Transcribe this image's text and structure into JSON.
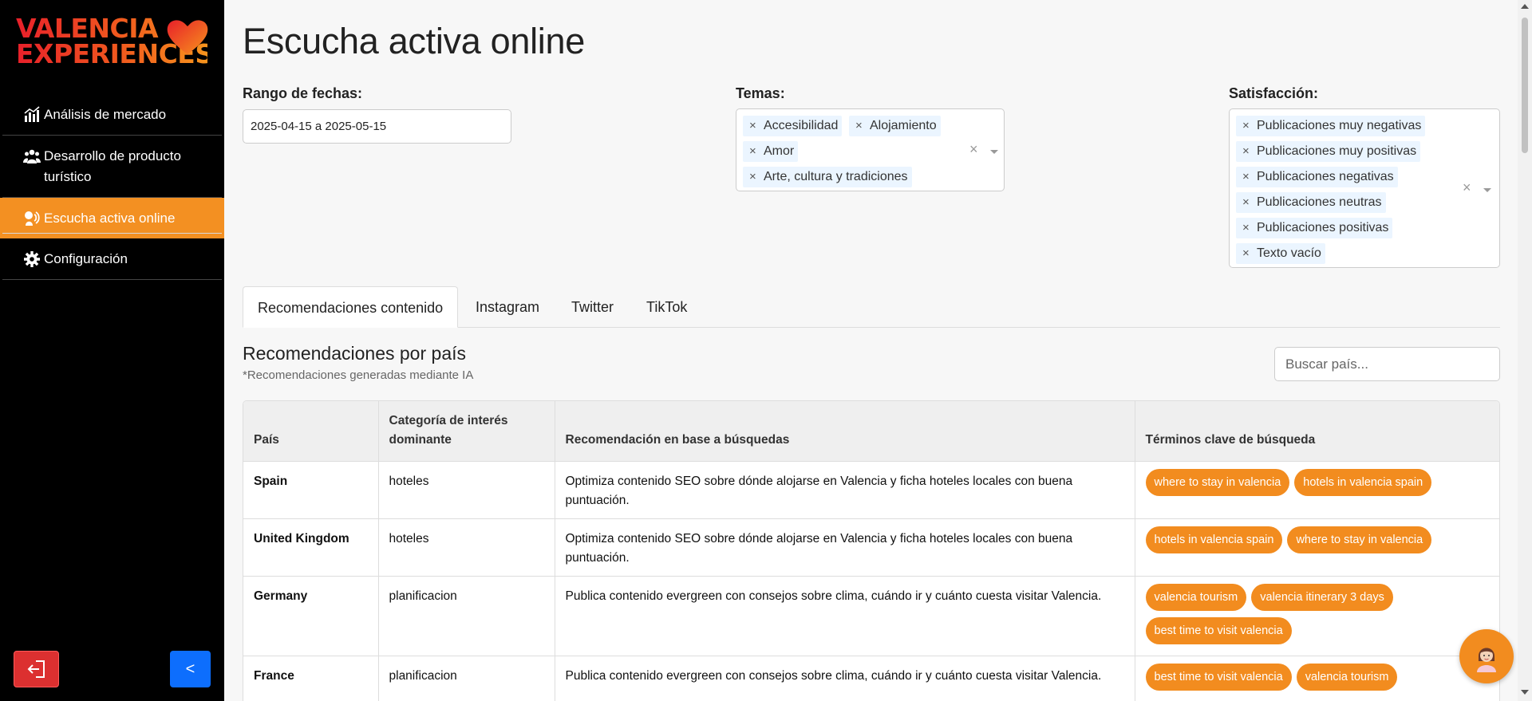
{
  "brand": {
    "line1": "VALENCIA",
    "line2": "EXPERIENCES"
  },
  "sidebar": {
    "items": [
      {
        "label": "Análisis de mercado",
        "icon": "chart-icon"
      },
      {
        "label": "Desarrollo de producto turístico",
        "icon": "people-icon"
      },
      {
        "label": "Escucha activa online",
        "icon": "ear-icon",
        "active": true
      },
      {
        "label": "Configuración",
        "icon": "gear-icon"
      }
    ],
    "logout_icon": "logout-icon",
    "collapse_label": "<"
  },
  "page": {
    "title": "Escucha activa online"
  },
  "filters": {
    "date": {
      "label": "Rango de fechas:",
      "value": "2025-04-15 a 2025-05-15"
    },
    "topics": {
      "label": "Temas:",
      "selected": [
        "Accesibilidad",
        "Alojamiento",
        "Amor",
        "Arte, cultura y tradiciones"
      ]
    },
    "satisfaction": {
      "label": "Satisfacción:",
      "selected": [
        "Publicaciones muy negativas",
        "Publicaciones muy positivas",
        "Publicaciones negativas",
        "Publicaciones neutras",
        "Publicaciones positivas",
        "Texto vacío"
      ]
    },
    "remove_glyph": "×"
  },
  "tabs": [
    "Recomendaciones contenido",
    "Instagram",
    "Twitter",
    "TikTok"
  ],
  "section": {
    "title": "Recomendaciones por país",
    "subtitle": "*Recomendaciones generadas mediante IA",
    "search_placeholder": "Buscar país..."
  },
  "table": {
    "headers": [
      "País",
      "Categoría de interés dominante",
      "Recomendación en base a búsquedas",
      "Términos clave de búsqueda"
    ],
    "rows": [
      {
        "country": "Spain",
        "category": "hoteles",
        "recommendation": "Optimiza contenido SEO sobre dónde alojarse en Valencia y ficha hoteles locales con buena puntuación.",
        "keywords": [
          "where to stay in valencia",
          "hotels in valencia spain"
        ]
      },
      {
        "country": "United Kingdom",
        "category": "hoteles",
        "recommendation": "Optimiza contenido SEO sobre dónde alojarse en Valencia y ficha hoteles locales con buena puntuación.",
        "keywords": [
          "hotels in valencia spain",
          "where to stay in valencia"
        ]
      },
      {
        "country": "Germany",
        "category": "planificacion",
        "recommendation": "Publica contenido evergreen con consejos sobre clima, cuándo ir y cuánto cuesta visitar Valencia.",
        "keywords": [
          "valencia tourism",
          "valencia itinerary 3 days",
          "best time to visit valencia"
        ]
      },
      {
        "country": "France",
        "category": "planificacion",
        "recommendation": "Publica contenido evergreen con consejos sobre clima, cuándo ir y cuánto cuesta visitar Valencia.",
        "keywords": [
          "best time to visit valencia",
          "valencia tourism"
        ]
      }
    ]
  },
  "colors": {
    "accent": "#f28c1f",
    "sidebar_bg": "#000000",
    "logout": "#dc3030",
    "collapse": "#0d6efd"
  },
  "assistant_icon": "assistant-avatar-icon"
}
